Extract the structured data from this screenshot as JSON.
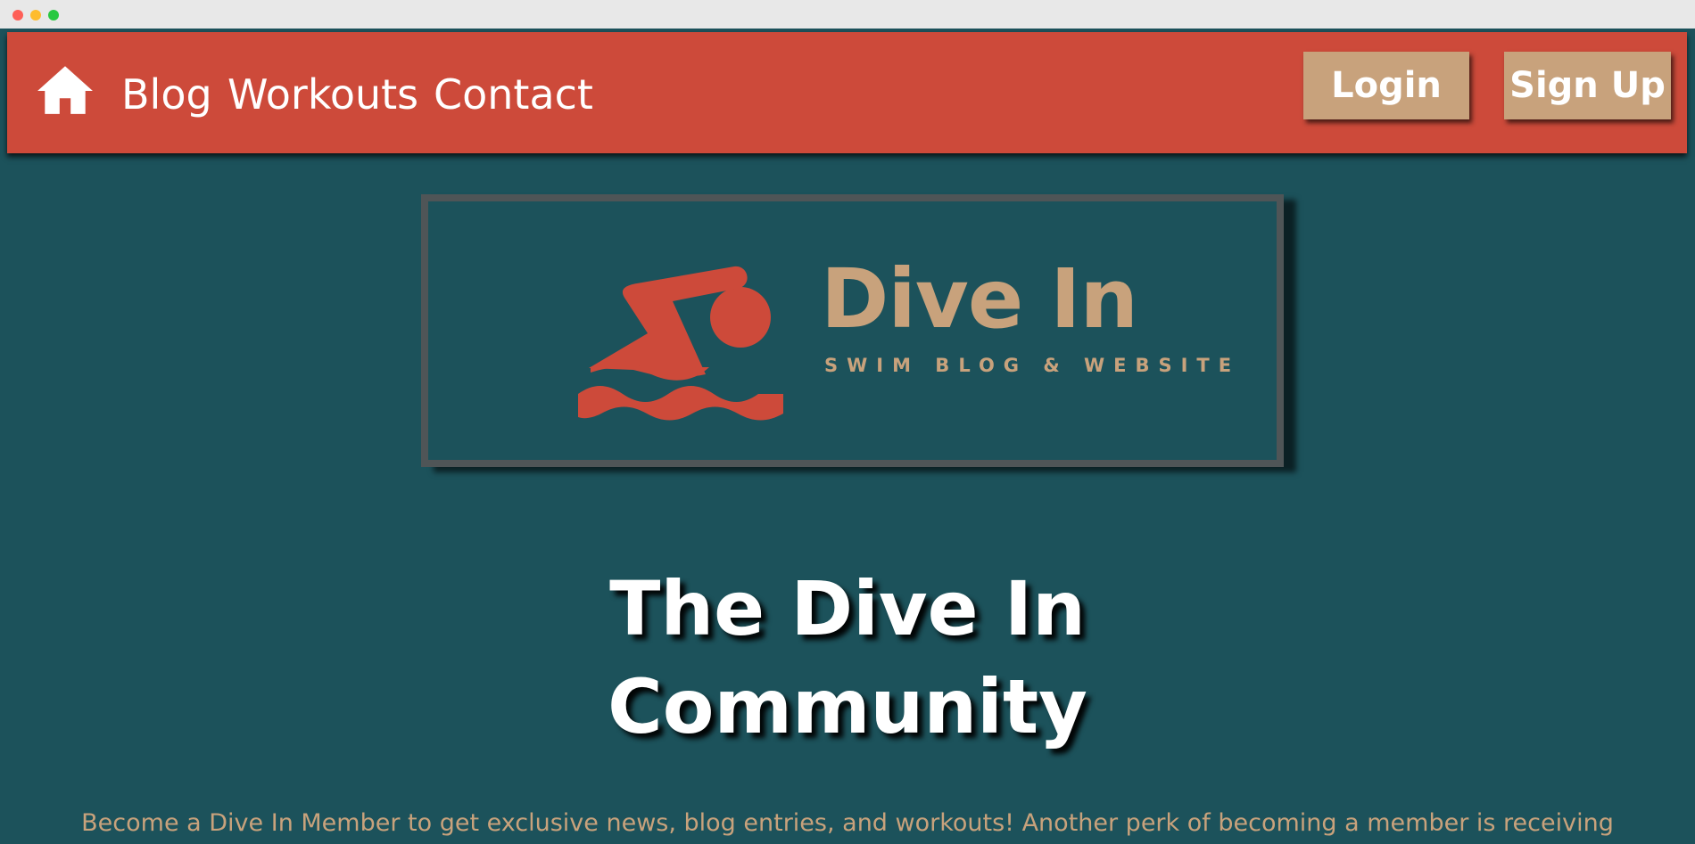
{
  "nav": {
    "links": [
      "Blog",
      "Workouts",
      "Contact"
    ],
    "login_label": "Login",
    "signup_label": "Sign Up"
  },
  "logo": {
    "title": "Dive In",
    "subtitle": "SWIM BLOG & WEBSITE"
  },
  "hero": {
    "headline_line1": "The Dive In",
    "headline_line2": "Community",
    "intro": "Become a Dive In Member to get exclusive news, blog entries, and workouts! Another perk of becoming a member is receiving"
  },
  "colors": {
    "background": "#1c525b",
    "navbar": "#cd4a3a",
    "accent": "#c8a27c",
    "frame": "#4f5557"
  },
  "icons": {
    "home": "home-icon",
    "logo": "swimmer-icon"
  }
}
